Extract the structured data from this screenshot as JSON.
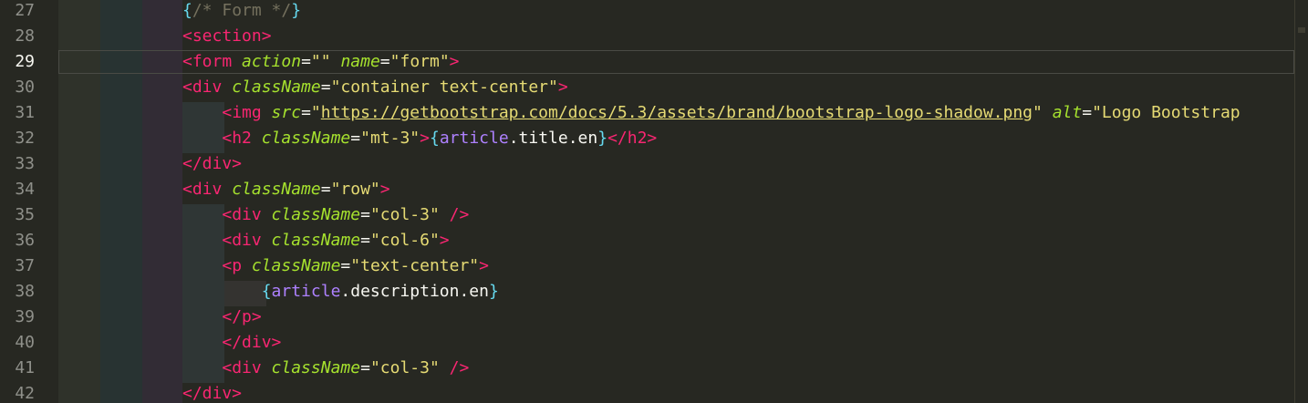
{
  "editor": {
    "current_line": 29,
    "line_numbers": [
      "27",
      "28",
      "29",
      "30",
      "31",
      "32",
      "33",
      "34",
      "35",
      "36",
      "37",
      "38",
      "39",
      "40",
      "41",
      "42"
    ],
    "lines": [
      [
        {
          "t": "{",
          "c": "brace"
        },
        {
          "t": "/* Form */",
          "c": "comment"
        },
        {
          "t": "}",
          "c": "brace"
        }
      ],
      [
        {
          "t": "<section>",
          "c": "tag"
        }
      ],
      [
        {
          "t": "<form ",
          "c": "tag"
        },
        {
          "t": "action",
          "c": "attr"
        },
        {
          "t": "=",
          "c": "plain"
        },
        {
          "t": "\"\"",
          "c": "str"
        },
        {
          "t": " ",
          "c": "plain"
        },
        {
          "t": "name",
          "c": "attr"
        },
        {
          "t": "=",
          "c": "plain"
        },
        {
          "t": "\"form\"",
          "c": "str"
        },
        {
          "t": ">",
          "c": "tag"
        }
      ],
      [
        {
          "t": "<div ",
          "c": "tag"
        },
        {
          "t": "className",
          "c": "attr"
        },
        {
          "t": "=",
          "c": "plain"
        },
        {
          "t": "\"container text-center\"",
          "c": "str"
        },
        {
          "t": ">",
          "c": "tag"
        }
      ],
      [
        {
          "t": "    ",
          "c": "plain"
        },
        {
          "t": "<img ",
          "c": "tag"
        },
        {
          "t": "src",
          "c": "attr"
        },
        {
          "t": "=",
          "c": "plain"
        },
        {
          "t": "\"",
          "c": "str"
        },
        {
          "t": "https://getbootstrap.com/docs/5.3/assets/brand/bootstrap-logo-shadow.png",
          "c": "str url"
        },
        {
          "t": "\"",
          "c": "str"
        },
        {
          "t": " ",
          "c": "plain"
        },
        {
          "t": "alt",
          "c": "attr"
        },
        {
          "t": "=",
          "c": "plain"
        },
        {
          "t": "\"Logo Bootstrap",
          "c": "str"
        }
      ],
      [
        {
          "t": "    ",
          "c": "plain"
        },
        {
          "t": "<h2 ",
          "c": "tag"
        },
        {
          "t": "className",
          "c": "attr"
        },
        {
          "t": "=",
          "c": "plain"
        },
        {
          "t": "\"mt-3\"",
          "c": "str"
        },
        {
          "t": ">",
          "c": "tag"
        },
        {
          "t": "{",
          "c": "brace"
        },
        {
          "t": "article",
          "c": "ident"
        },
        {
          "t": ".title.en",
          "c": "plain"
        },
        {
          "t": "}",
          "c": "brace"
        },
        {
          "t": "</h2>",
          "c": "tag"
        }
      ],
      [
        {
          "t": "</div>",
          "c": "tag"
        }
      ],
      [
        {
          "t": "<div ",
          "c": "tag"
        },
        {
          "t": "className",
          "c": "attr"
        },
        {
          "t": "=",
          "c": "plain"
        },
        {
          "t": "\"row\"",
          "c": "str"
        },
        {
          "t": ">",
          "c": "tag"
        }
      ],
      [
        {
          "t": "    ",
          "c": "plain"
        },
        {
          "t": "<div ",
          "c": "tag"
        },
        {
          "t": "className",
          "c": "attr"
        },
        {
          "t": "=",
          "c": "plain"
        },
        {
          "t": "\"col-3\"",
          "c": "str"
        },
        {
          "t": " />",
          "c": "tag"
        }
      ],
      [
        {
          "t": "    ",
          "c": "plain"
        },
        {
          "t": "<div ",
          "c": "tag"
        },
        {
          "t": "className",
          "c": "attr"
        },
        {
          "t": "=",
          "c": "plain"
        },
        {
          "t": "\"col-6\"",
          "c": "str"
        },
        {
          "t": ">",
          "c": "tag"
        }
      ],
      [
        {
          "t": "    ",
          "c": "plain"
        },
        {
          "t": "<p ",
          "c": "tag"
        },
        {
          "t": "className",
          "c": "attr"
        },
        {
          "t": "=",
          "c": "plain"
        },
        {
          "t": "\"text-center\"",
          "c": "str"
        },
        {
          "t": ">",
          "c": "tag"
        }
      ],
      [
        {
          "t": "        ",
          "c": "plain"
        },
        {
          "t": "{",
          "c": "brace"
        },
        {
          "t": "article",
          "c": "ident"
        },
        {
          "t": ".description.en",
          "c": "plain"
        },
        {
          "t": "}",
          "c": "brace"
        }
      ],
      [
        {
          "t": "    ",
          "c": "plain"
        },
        {
          "t": "</p>",
          "c": "tag"
        }
      ],
      [
        {
          "t": "    ",
          "c": "plain"
        },
        {
          "t": "</div>",
          "c": "tag"
        }
      ],
      [
        {
          "t": "    ",
          "c": "plain"
        },
        {
          "t": "<div ",
          "c": "tag"
        },
        {
          "t": "className",
          "c": "attr"
        },
        {
          "t": "=",
          "c": "plain"
        },
        {
          "t": "\"col-3\"",
          "c": "str"
        },
        {
          "t": " />",
          "c": "tag"
        }
      ],
      [
        {
          "t": "</div>",
          "c": "tag"
        }
      ]
    ]
  },
  "colors": {
    "background": "#272822",
    "tag": "#f92672",
    "attribute": "#a6e22e",
    "string": "#e6db74",
    "brace": "#66d9ef",
    "identifier": "#ae81ff",
    "comment": "#75715e"
  }
}
